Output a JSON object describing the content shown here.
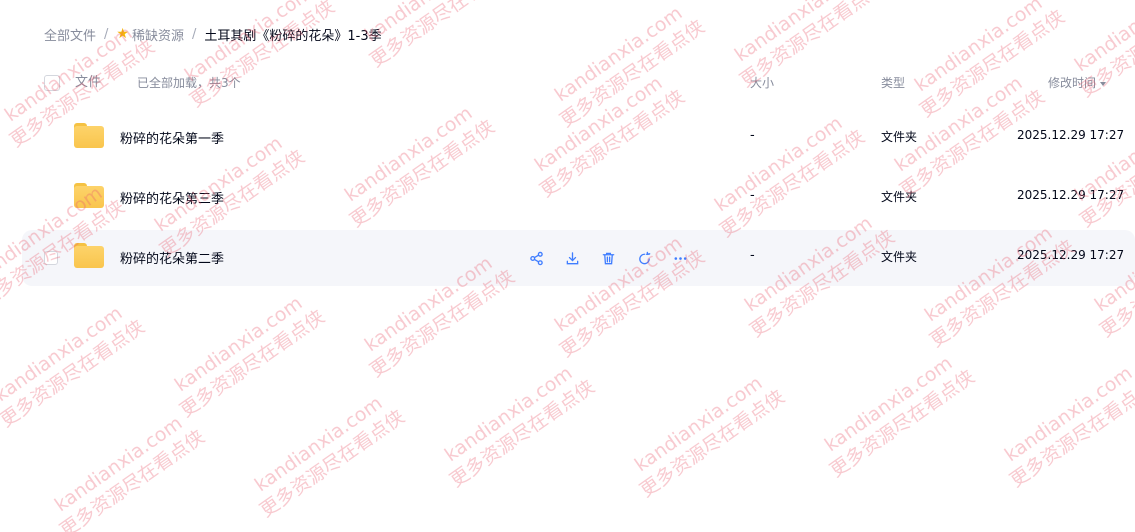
{
  "breadcrumb": {
    "root": "全部文件",
    "sep": "/",
    "parent": "稀缺资源",
    "current": "土耳其剧《粉碎的花朵》1-3季"
  },
  "header": {
    "name_label": "文件",
    "loaded_label": "已全部加载，共3个",
    "size_label": "大小",
    "type_label": "类型",
    "mtime_label": "修改时间"
  },
  "files": [
    {
      "name": "粉碎的花朵第一季",
      "size": "-",
      "type": "文件夹",
      "mtime": "2025.12.29 17:27"
    },
    {
      "name": "粉碎的花朵第三季",
      "size": "-",
      "type": "文件夹",
      "mtime": "2025.12.29 17:27"
    },
    {
      "name": "粉碎的花朵第二季",
      "size": "-",
      "type": "文件夹",
      "mtime": "2025.12.29 17:27"
    }
  ],
  "row_actions": [
    "share-icon",
    "download-icon",
    "delete-icon",
    "rename-icon",
    "more-icon"
  ],
  "watermark": {
    "line1": "kandianxia.com",
    "line2": "更多资源尽在看点侠"
  },
  "colors": {
    "accent": "#0d53ff",
    "action_icon": "#3f7dff",
    "folder": "#f9c54d",
    "hover_row": "#f5f6fa",
    "watermark": "#e85a6e"
  }
}
